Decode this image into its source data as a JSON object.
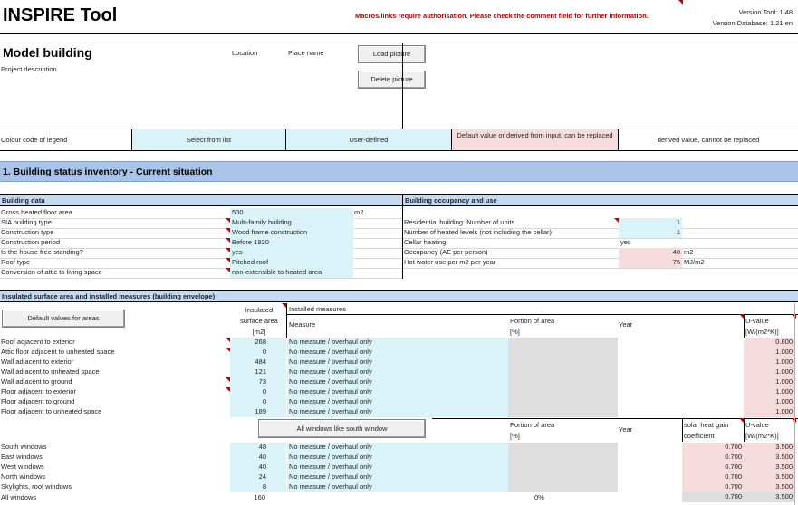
{
  "header": {
    "title": "INSPIRE Tool",
    "warning": "Macros/links require authorisation. Please check the comment field for further information.",
    "version_tool": "Version Tool: 1.48",
    "version_db": "Version Database: 1.21 en"
  },
  "project": {
    "name": "Model building",
    "description_label": "Project description",
    "location_label": "Location",
    "place_label": "Place name",
    "load_picture": "Load picture",
    "delete_picture": "Delete picture"
  },
  "legend": {
    "label": "Colour code of legend",
    "select": "Select from list",
    "user": "User-defined",
    "default": "Default value or derived from input, can be replaced",
    "derived": "derived value, cannot be replaced"
  },
  "section1": {
    "title": "1. Building status inventory - Current situation"
  },
  "building_data": {
    "header": "Building data",
    "rows": [
      {
        "label": "Gross heated floor area",
        "value": "500",
        "unit": "m2"
      },
      {
        "label": "SIA building type",
        "value": "Multi-family building",
        "unit": ""
      },
      {
        "label": "Construction type",
        "value": "Wood frame construction",
        "unit": ""
      },
      {
        "label": "Construction period",
        "value": "Before 1920",
        "unit": ""
      },
      {
        "label": "Is the house free-standing?",
        "value": "yes",
        "unit": ""
      },
      {
        "label": "Roof type",
        "value": "Pitched roof",
        "unit": ""
      },
      {
        "label": "Conversion of attic to living space",
        "value": "non-extensible to heated area",
        "unit": ""
      }
    ]
  },
  "occupancy": {
    "header": "Building occupancy and use",
    "rows": [
      {
        "label": "Residential building: Number of units",
        "value": "1",
        "unit": ""
      },
      {
        "label": "Number of heated levels (not including the cellar)",
        "value": "1",
        "unit": ""
      },
      {
        "label": "Cellar heating",
        "value": "yes",
        "unit": ""
      },
      {
        "label": "Occupancy (AE per person)",
        "value": "40",
        "unit": "m2"
      },
      {
        "label": "Hot water use per m2 per year",
        "value": "75",
        "unit": "MJ/m2"
      }
    ]
  },
  "envelope": {
    "header": "Insulated surface area and installed measures (building envelope)",
    "default_button": "Default values for areas",
    "col_area_1": "Insulated",
    "col_area_2": "surface area",
    "col_area_3": "[m2]",
    "col_installed": "Installed measures",
    "col_measure": "Measure",
    "col_portion_1": "Portion of area",
    "col_portion_2": "[%]",
    "col_year": "Year",
    "col_u_1": "U-value",
    "col_u_2": "[W/(m2*K)]",
    "rows": [
      {
        "label": "Roof adjacent to exterior",
        "area": "268",
        "measure": "No measure / overhaul only",
        "u": "0.800"
      },
      {
        "label": "Attic floor adjacent to unheated space",
        "area": "0",
        "measure": "No measure / overhaul only",
        "u": "1.000"
      },
      {
        "label": "Wall adjacent to exterior",
        "area": "484",
        "measure": "No measure / overhaul only",
        "u": "1.000"
      },
      {
        "label": "Wall adjacent to unheated space",
        "area": "121",
        "measure": "No measure / overhaul only",
        "u": "1.000"
      },
      {
        "label": "Wall adjacent to ground",
        "area": "73",
        "measure": "No measure / overhaul only",
        "u": "1.000"
      },
      {
        "label": "Floor adjacent to exterior",
        "area": "0",
        "measure": "No measure / overhaul only",
        "u": "1.000"
      },
      {
        "label": "Floor adjacent to ground",
        "area": "0",
        "measure": "No measure / overhaul only",
        "u": "1.000"
      },
      {
        "label": "Floor adjacent to unheated space",
        "area": "189",
        "measure": "No measure / overhaul only",
        "u": "1.000"
      }
    ],
    "windows_button": "All windows like south window",
    "col_g_1": "solar heat gain",
    "col_g_2": "coefficient",
    "windows": [
      {
        "label": "South windows",
        "area": "48",
        "measure": "No measure / overhaul only",
        "g": "0.700",
        "u": "3.500"
      },
      {
        "label": "East windows",
        "area": "40",
        "measure": "No measure / overhaul only",
        "g": "0.700",
        "u": "3.500"
      },
      {
        "label": "West windows",
        "area": "40",
        "measure": "No measure / overhaul only",
        "g": "0.700",
        "u": "3.500"
      },
      {
        "label": "North windows",
        "area": "24",
        "measure": "No measure / overhaul only",
        "g": "0.700",
        "u": "3.500"
      },
      {
        "label": "Skylights, roof windows",
        "area": "8",
        "measure": "No measure / overhaul only",
        "g": "0.700",
        "u": "3.500"
      }
    ],
    "all_windows": {
      "label": "All windows",
      "area": "160",
      "portion": "0%",
      "g": "0.700",
      "u": "3.500"
    }
  },
  "colors": {
    "select": "#d9f3f8",
    "default": "#f6dcdc",
    "derived": "#dedede",
    "band": "#a8c4e8",
    "subhead": "#c5d9f1",
    "warning": "#c00000"
  }
}
